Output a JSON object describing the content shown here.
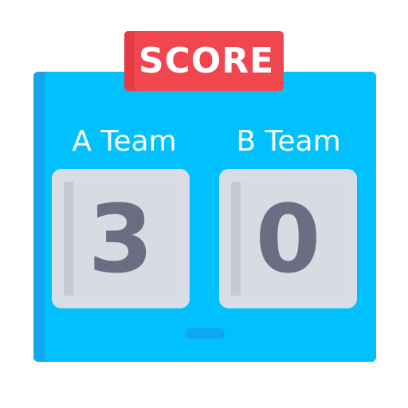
{
  "header": {
    "label": "SCORE"
  },
  "teams": [
    {
      "name": "A Team",
      "score": "3"
    },
    {
      "name": "B Team",
      "score": "0"
    }
  ],
  "colors": {
    "board": "#00c0fd",
    "board_shade": "#11a6ee",
    "tag": "#f1454f",
    "card": "#dadde6",
    "digit": "#6b6e82"
  }
}
